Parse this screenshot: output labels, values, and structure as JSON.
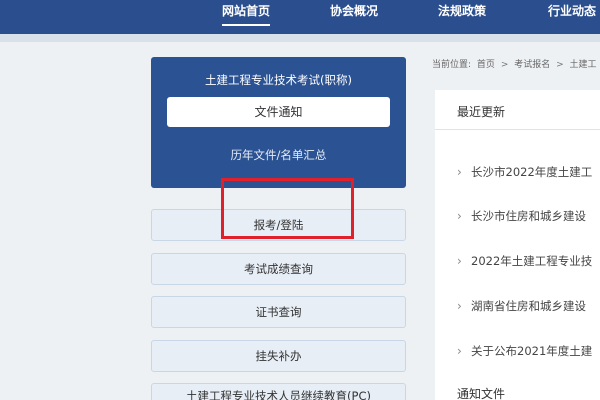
{
  "nav": {
    "items": [
      {
        "label": "网站首页",
        "active": true
      },
      {
        "label": "协会概况",
        "active": false
      },
      {
        "label": "法规政策",
        "active": false
      },
      {
        "label": "行业动态",
        "active": false
      }
    ]
  },
  "left": {
    "panel": {
      "title": "土建工程专业技术考试(职称)",
      "button": "文件通知",
      "link": "历年文件/名单汇总"
    },
    "menu": [
      "报考/登陆",
      "考试成绩查询",
      "证书查询",
      "挂失补办",
      "土建工程专业技术人员继续教育(PC)"
    ]
  },
  "breadcrumb": {
    "prefix": "当前位置:",
    "items": [
      "首页",
      "考试报名",
      "土建工"
    ],
    "separator": ">"
  },
  "news": {
    "title": "最近更新",
    "items": [
      "长沙市2022年度土建工",
      "长沙市住房和城乡建设",
      "2022年土建工程专业技",
      "湖南省住房和城乡建设",
      "关于公布2021年度土建"
    ]
  },
  "notice": {
    "title": "通知文件"
  },
  "colors": {
    "nav": "#2b4e8e",
    "panel": "#2b5293",
    "highlight": "#e0212b",
    "menu_bg": "#e7eef6"
  }
}
